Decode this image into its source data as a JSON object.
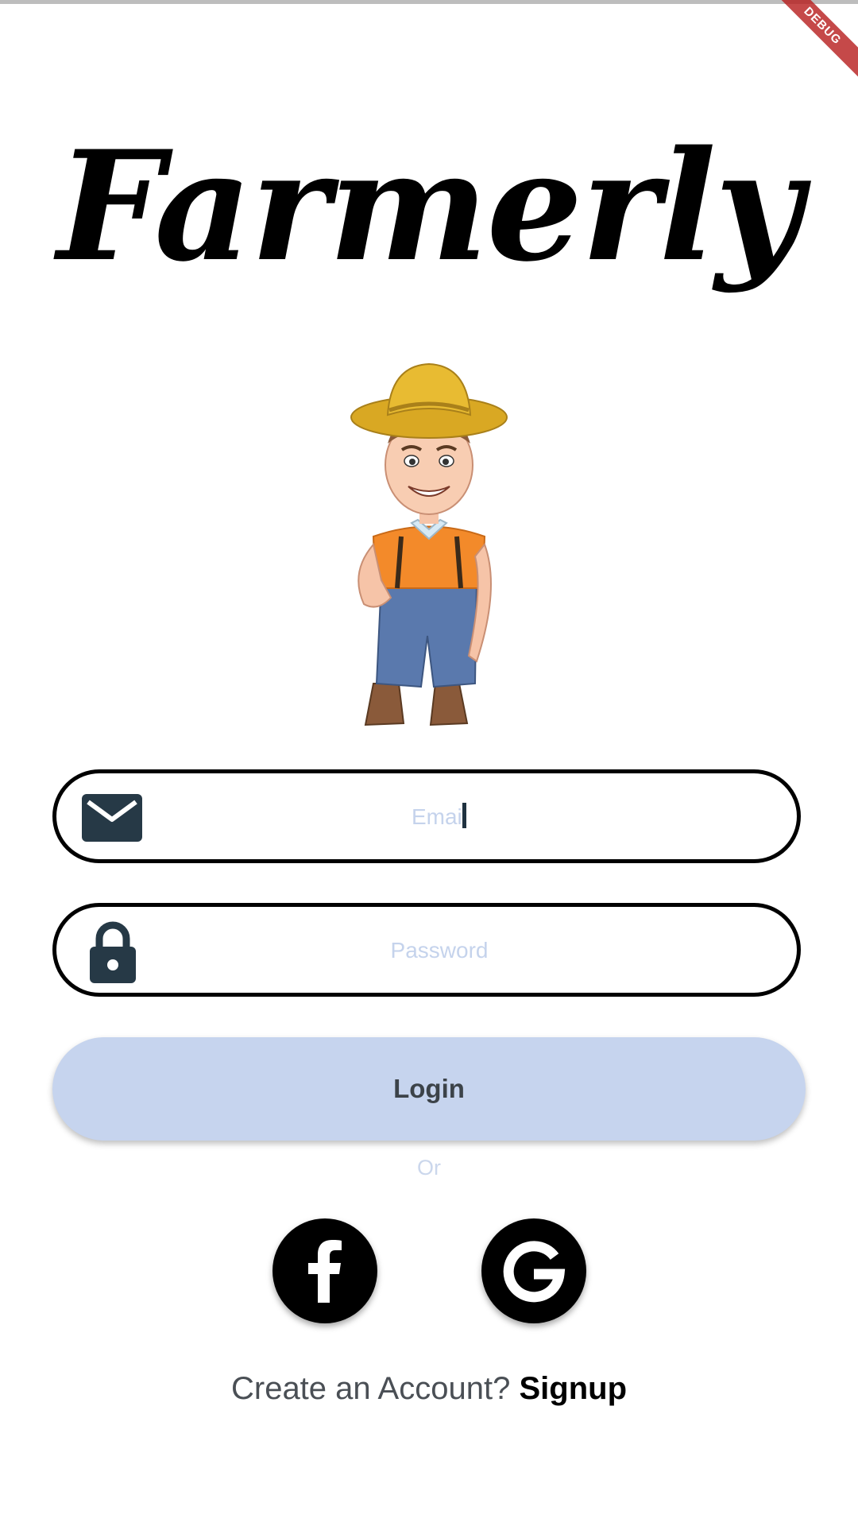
{
  "app": {
    "logo_text": "Farmerly",
    "debug_banner": "DEBUG"
  },
  "form": {
    "email_placeholder": "Email",
    "password_placeholder": "Password",
    "login_label": "Login",
    "or_label": "Or"
  },
  "social": {
    "facebook_icon": "facebook-icon",
    "google_icon": "google-icon"
  },
  "footer": {
    "prompt": "Create an Account?",
    "signup_label": "Signup"
  },
  "icons": {
    "email": "mail-icon",
    "password": "lock-icon"
  },
  "colors": {
    "login_button": "#c6d4ee",
    "placeholder": "#c5d3ec",
    "icon_dark": "#263946"
  }
}
